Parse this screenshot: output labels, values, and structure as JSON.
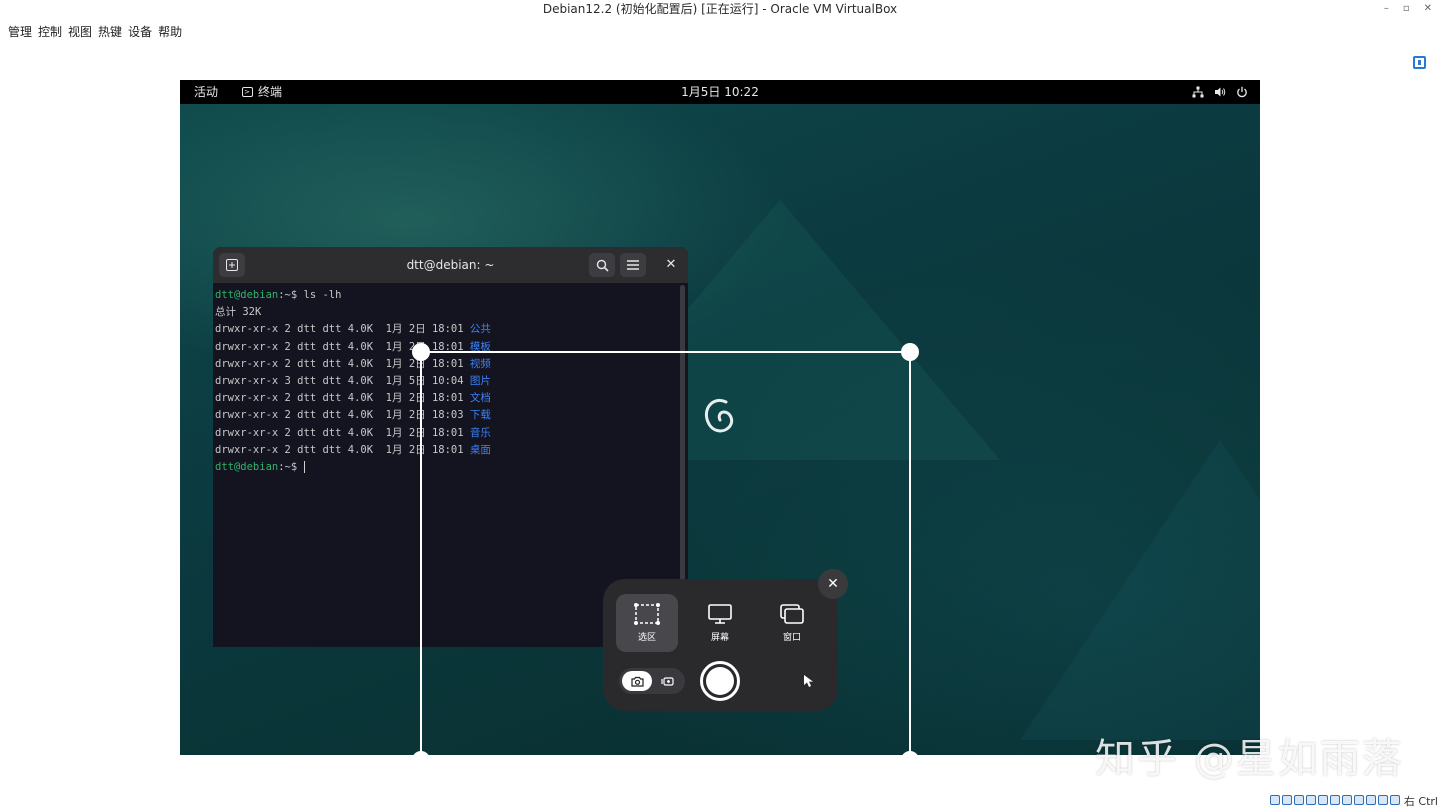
{
  "host": {
    "title": "Debian12.2 (初始化配置后) [正在运行] - Oracle VM VirtualBox",
    "controls": [
      "–",
      "▫",
      "✕"
    ],
    "menu": [
      "管理",
      "控制",
      "视图",
      "热键",
      "设备",
      "帮助"
    ],
    "host_key": "右 Ctrl"
  },
  "gnome": {
    "activities": "活动",
    "app_name": "终端",
    "clock": "1月5日 10:22"
  },
  "terminal": {
    "title": "dtt@debian: ~",
    "prompt_user": "dtt@debian",
    "command_line": ":~$ ls -lh",
    "total": "总计 32K",
    "rows": [
      {
        "meta": "drwxr-xr-x 2 dtt dtt 4.0K  1月 2日 18:01 ",
        "name": "公共"
      },
      {
        "meta": "drwxr-xr-x 2 dtt dtt 4.0K  1月 2日 18:01 ",
        "name": "模板"
      },
      {
        "meta": "drwxr-xr-x 2 dtt dtt 4.0K  1月 2日 18:01 ",
        "name": "视频"
      },
      {
        "meta": "drwxr-xr-x 3 dtt dtt 4.0K  1月 5日 10:04 ",
        "name": "图片"
      },
      {
        "meta": "drwxr-xr-x 2 dtt dtt 4.0K  1月 2日 18:01 ",
        "name": "文档"
      },
      {
        "meta": "drwxr-xr-x 2 dtt dtt 4.0K  1月 2日 18:03 ",
        "name": "下载"
      },
      {
        "meta": "drwxr-xr-x 2 dtt dtt 4.0K  1月 2日 18:01 ",
        "name": "音乐"
      },
      {
        "meta": "drwxr-xr-x 2 dtt dtt 4.0K  1月 2日 18:01 ",
        "name": "桌面"
      }
    ],
    "final_prompt": ":~$ "
  },
  "screenshot_ui": {
    "modes": [
      {
        "label": "选区",
        "icon": "selection-icon",
        "active": true
      },
      {
        "label": "屏幕",
        "icon": "monitor-icon",
        "active": false
      },
      {
        "label": "窗口",
        "icon": "window-icon",
        "active": false
      }
    ],
    "close": "✕"
  },
  "watermark": "知乎 @星如雨落",
  "colors": {
    "prompt_green": "#2fb36b",
    "dir_blue": "#3b82f6",
    "panel_bg": "#2a2a2d",
    "topbar_bg": "#000000"
  }
}
